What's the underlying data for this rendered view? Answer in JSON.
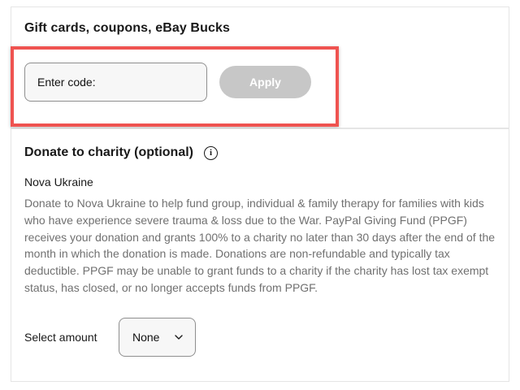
{
  "gift": {
    "title": "Gift cards, coupons, eBay Bucks",
    "code_placeholder": "Enter code:",
    "apply_label": "Apply"
  },
  "donate": {
    "title": "Donate to charity (optional)",
    "info_icon": "info-icon",
    "info_glyph": "i",
    "charity_name": "Nova Ukraine",
    "description": "Donate to Nova Ukraine to help fund group, individual & family therapy for families with kids who have experience severe trauma & loss due to the War. PayPal Giving Fund (PPGF) receives your donation and grants 100% to a charity no later than 30 days after the end of the month in which the donation is made. Donations are non-refundable and typically tax deductible. PPGF may be unable to grant funds to a charity if the charity has lost tax exempt status, has closed, or no longer accepts funds from PPGF.",
    "amount_label": "Select amount",
    "amount_selected": "None",
    "amount_icon": "chevron-down-icon"
  },
  "colors": {
    "highlight_border": "#ef5350",
    "apply_disabled_bg": "#c7c7c7",
    "muted_text": "#707070"
  }
}
